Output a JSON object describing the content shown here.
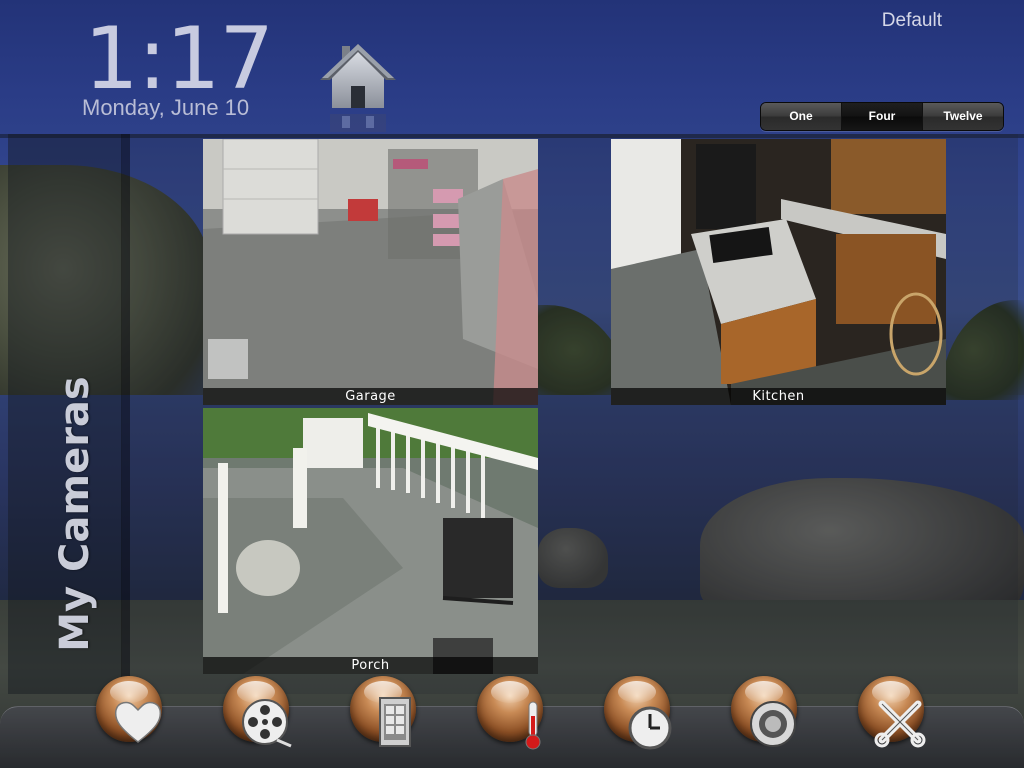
{
  "header": {
    "time": "1:17",
    "date": "Monday, June 10",
    "profile": "Default"
  },
  "view_selector": {
    "options": [
      "One",
      "Four",
      "Twelve"
    ],
    "selected": "Four"
  },
  "sidebar": {
    "title": "My Cameras"
  },
  "cameras": [
    {
      "label": "Garage"
    },
    {
      "label": "Kitchen"
    },
    {
      "label": "Porch"
    }
  ],
  "dock": {
    "items": [
      {
        "icon": "heart-icon"
      },
      {
        "icon": "film-reel-icon"
      },
      {
        "icon": "door-icon"
      },
      {
        "icon": "thermometer-icon"
      },
      {
        "icon": "clock-icon"
      },
      {
        "icon": "speaker-icon"
      },
      {
        "icon": "tools-icon"
      }
    ]
  },
  "colors": {
    "sky_top": "#233378",
    "orb_accent": "#c88a55",
    "selected_segment": "#121212"
  }
}
